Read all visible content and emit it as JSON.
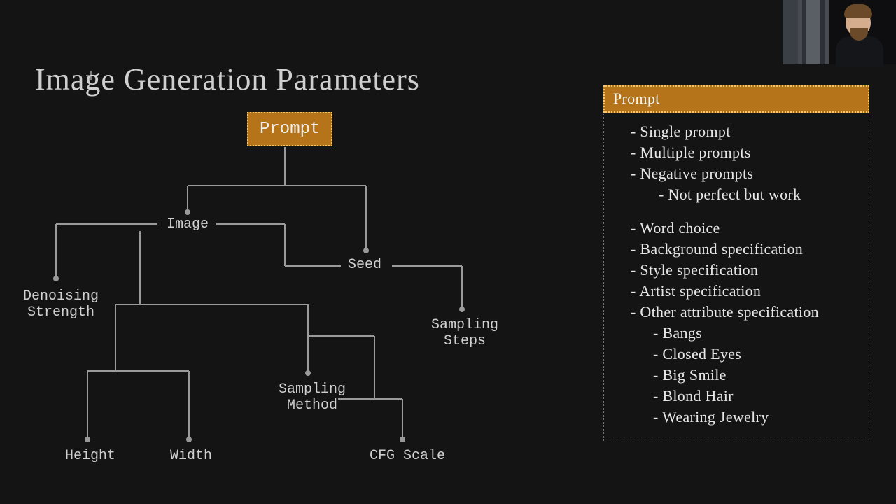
{
  "title": "Image Generation Parameters",
  "nodes": {
    "prompt": "Prompt",
    "image": "Image",
    "denoise": "Denoising\nStrength",
    "seed": "Seed",
    "sampsteps": "Sampling\nSteps",
    "sampmethod": "Sampling\nMethod",
    "cfg": "CFG Scale",
    "height": "Height",
    "width": "Width"
  },
  "panel": {
    "heading": "Prompt",
    "b1": "- Single prompt",
    "b2": "- Multiple prompts",
    "b3": "- Negative prompts",
    "b3a": "- Not perfect but work",
    "b4": "- Word choice",
    "b5": "- Background specification",
    "b6": "- Style specification",
    "b7": "- Artist specification",
    "b8": "- Other attribute specification",
    "b8a": "- Bangs",
    "b8b": "- Closed Eyes",
    "b8c": "- Big Smile",
    "b8d": "- Blond Hair",
    "b8e": "- Wearing Jewelry"
  },
  "chart_data": {
    "type": "tree",
    "title": "Image Generation Parameters",
    "root": "Prompt",
    "edges": [
      [
        "Prompt",
        "Image"
      ],
      [
        "Prompt",
        "Seed"
      ],
      [
        "Image",
        "Denoising Strength"
      ],
      [
        "Image",
        "Seed"
      ],
      [
        "Image",
        "Height"
      ],
      [
        "Image",
        "Width"
      ],
      [
        "Seed",
        "Sampling Steps"
      ],
      [
        "Seed",
        "Sampling Method"
      ],
      [
        "Seed",
        "CFG Scale"
      ]
    ],
    "notes_panel": {
      "heading": "Prompt",
      "bullets": [
        "Single prompt",
        "Multiple prompts",
        {
          "text": "Negative prompts",
          "children": [
            "Not perfect but work"
          ]
        },
        "Word choice",
        "Background specification",
        "Style specification",
        "Artist specification",
        {
          "text": "Other attribute specification",
          "children": [
            "Bangs",
            "Closed Eyes",
            "Big Smile",
            "Blond Hair",
            "Wearing Jewelry"
          ]
        }
      ]
    }
  }
}
